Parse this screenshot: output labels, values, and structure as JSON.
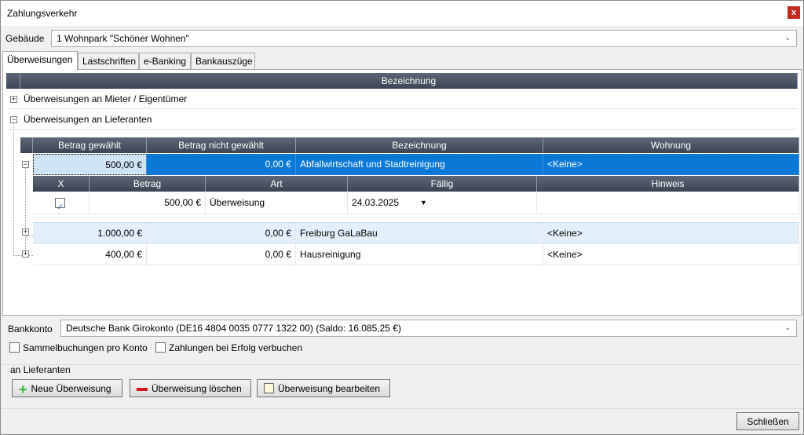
{
  "window": {
    "title": "Zahlungsverkehr",
    "close_label": "x"
  },
  "gebaeude": {
    "label": "Gebäude",
    "value": "1 Wohnpark \"Schöner Wohnen\""
  },
  "tabs": [
    {
      "label": "Überweisungen",
      "active": true
    },
    {
      "label": "Lastschriften",
      "active": false
    },
    {
      "label": "e-Banking",
      "active": false
    },
    {
      "label": "Bankauszüge",
      "active": false
    }
  ],
  "grid": {
    "header": "Bezeichnung",
    "groups": [
      {
        "label": "Überweisungen an Mieter / Eigentümer",
        "expanded": false
      },
      {
        "label": "Überweisungen an Lieferanten",
        "expanded": true
      }
    ],
    "sub_headers": [
      "Betrag gewählt",
      "Betrag nicht gewählt",
      "Bezeichnung",
      "Wohnung"
    ],
    "rows": [
      {
        "betrag_gewaehlt": "500,00 €",
        "betrag_nicht": "0,00 €",
        "bezeichnung": "Abfallwirtschaft und Stadtreinigung",
        "wohnung": "<Keine>",
        "expanded": true,
        "selected": true
      },
      {
        "betrag_gewaehlt": "1.000,00 €",
        "betrag_nicht": "0,00 €",
        "bezeichnung": "Freiburg GaLaBau",
        "wohnung": "<Keine>",
        "expanded": false
      },
      {
        "betrag_gewaehlt": "400,00 €",
        "betrag_nicht": "0,00 €",
        "bezeichnung": "Hausreinigung",
        "wohnung": "<Keine>",
        "expanded": false
      }
    ],
    "detail_headers": [
      "X",
      "Betrag",
      "Art",
      "Fällig",
      "Hinweis"
    ],
    "detail_row": {
      "checked": true,
      "betrag": "500,00 €",
      "art": "Überweisung",
      "faellig": "24.03.2025",
      "hinweis": ""
    }
  },
  "bankkonto": {
    "label": "Bankkonto",
    "value": "Deutsche Bank Girokonto (DE16 4804 0035 0777 1322 00) (Saldo: 16.085,25 €)"
  },
  "options": {
    "sammel": "Sammelbuchungen pro Konto",
    "erfolg": "Zahlungen bei Erfolg verbuchen"
  },
  "group_box": {
    "title": "an Lieferanten",
    "new_label": "Neue Überweisung",
    "delete_label": "Überweisung löschen",
    "edit_label": "Überweisung bearbeiten"
  },
  "footer": {
    "close_label": "Schließen"
  },
  "colors": {
    "selection": "#0a78d7",
    "header": "#3a4454",
    "add": "#2bbd2b",
    "delete": "#d01919"
  }
}
